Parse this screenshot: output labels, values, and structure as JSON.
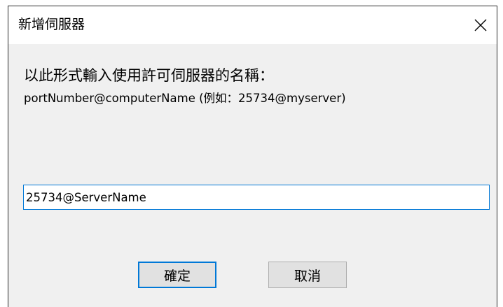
{
  "window": {
    "title": "新增伺服器",
    "close_icon": "close-icon"
  },
  "content": {
    "prompt": "以此形式輸入使用許可伺服器的名稱：",
    "example": "portNumber@computerName (例如：25734@myserver)"
  },
  "input": {
    "value": "25734@ServerName"
  },
  "buttons": {
    "ok_label": "確定",
    "cancel_label": "取消"
  },
  "colors": {
    "accent": "#0078d7",
    "dialog_background": "#f0f0f0",
    "titlebar_background": "#ffffff",
    "button_background": "#e1e1e1"
  }
}
